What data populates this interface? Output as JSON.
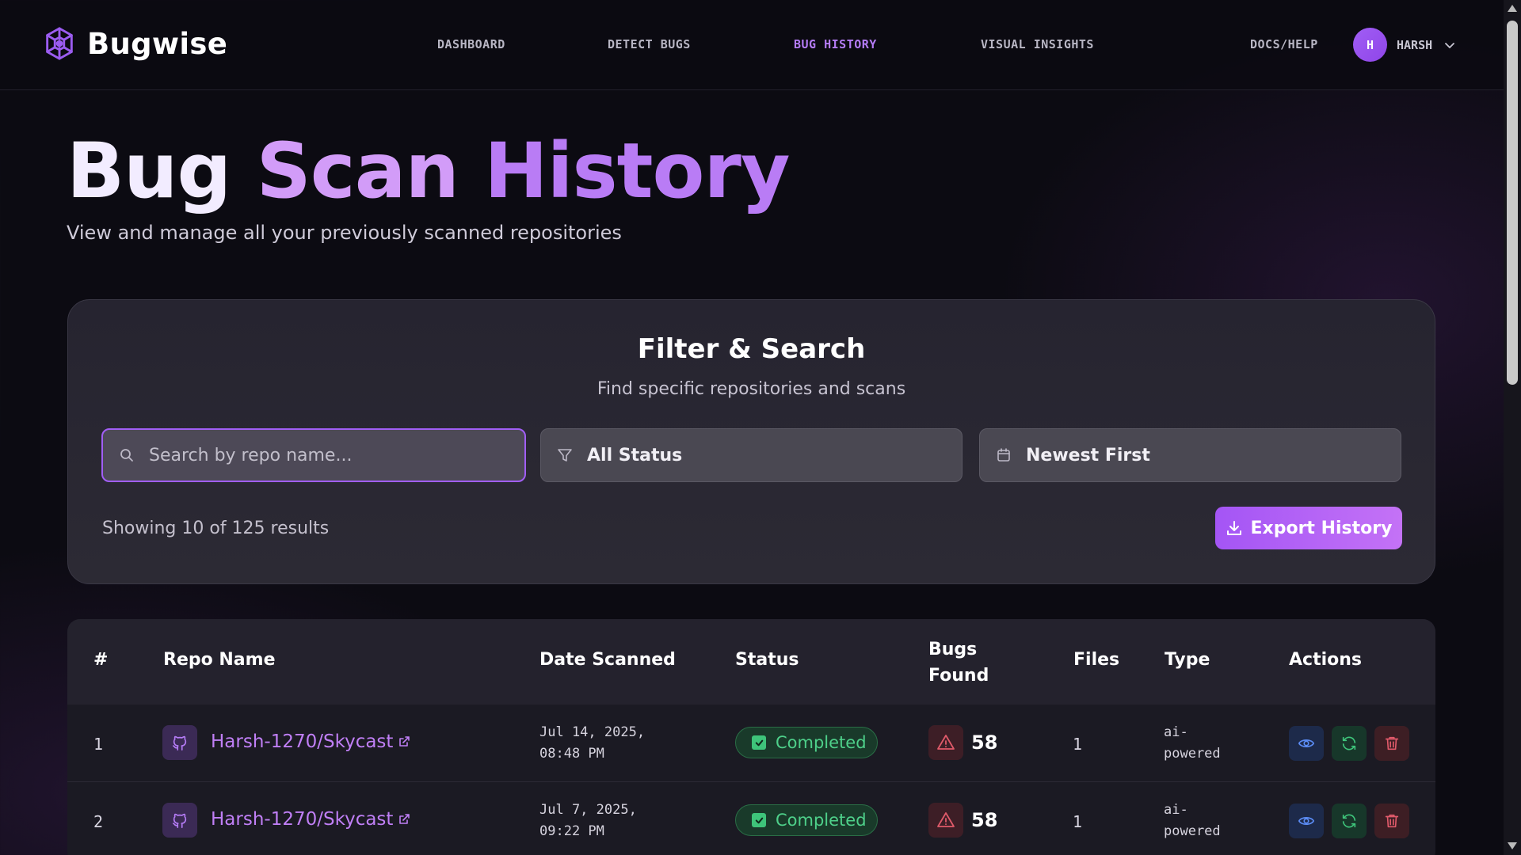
{
  "app": {
    "name": "Bugwise"
  },
  "nav": {
    "items": [
      "DASHBOARD",
      "DETECT BUGS",
      "BUG HISTORY",
      "VISUAL INSIGHTS"
    ],
    "active": "BUG HISTORY",
    "docs": "DOCS/HELP",
    "user_initial": "H",
    "user_name": "HARSH"
  },
  "page": {
    "title_words": [
      "Bug",
      "Scan",
      "History"
    ],
    "subtitle": "View and manage all your previously scanned repositories"
  },
  "filter": {
    "title": "Filter & Search",
    "subtitle": "Find specific repositories and scans",
    "search_placeholder": "Search by repo name...",
    "search_value": "",
    "status_value": "All Status",
    "sort_value": "Newest First",
    "results_text": "Showing 10 of 125 results",
    "export_label": "Export History"
  },
  "table": {
    "headers": [
      "#",
      "Repo Name",
      "Date Scanned",
      "Status",
      "Bugs Found",
      "Files",
      "Type",
      "Actions"
    ],
    "rows": [
      {
        "index": "1",
        "repo": "Harsh-1270/Skycast",
        "date_line1": "Jul 14, 2025,",
        "date_line2": "08:48 PM",
        "status": "Completed",
        "bugs": "58",
        "files": "1",
        "type_line1": "ai-",
        "type_line2": "powered"
      },
      {
        "index": "2",
        "repo": "Harsh-1270/Skycast",
        "date_line1": "Jul 7, 2025,",
        "date_line2": "09:22 PM",
        "status": "Completed",
        "bugs": "58",
        "files": "1",
        "type_line1": "ai-",
        "type_line2": "powered"
      }
    ]
  },
  "colors": {
    "accent": "#a455f5",
    "background": "#0c0b12",
    "success": "#4ed08a",
    "danger": "#e05a6a"
  },
  "icons": {
    "logo": "brain-circuit-icon",
    "search": "search-icon",
    "status": "filter-icon",
    "sort": "calendar-icon",
    "export": "download-icon",
    "repo": "github-icon",
    "external": "external-link-icon",
    "status_ok": "check-icon",
    "bugs": "warning-icon",
    "view": "eye-icon",
    "rescan": "refresh-icon",
    "delete": "trash-icon"
  }
}
